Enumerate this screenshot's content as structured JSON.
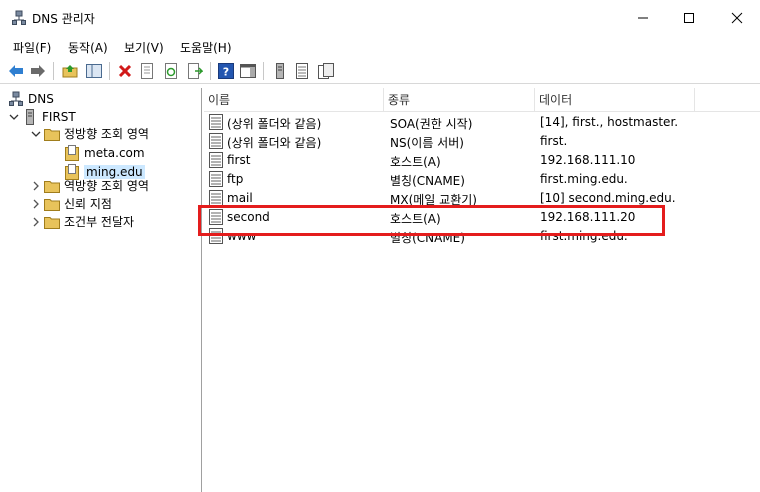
{
  "window": {
    "title": "DNS 관리자"
  },
  "menu": [
    "파일(F)",
    "동작(A)",
    "보기(V)",
    "도움말(H)"
  ],
  "toolbar": {
    "buttons": [
      "back-icon",
      "forward-icon",
      "up-folder-icon",
      "show-tree-icon",
      "delete-icon",
      "properties-icon",
      "refresh-icon",
      "export-icon",
      "help-icon",
      "action-pane-icon",
      "server-icon",
      "record-list-icon",
      "zone-icon"
    ]
  },
  "tree": {
    "root": "DNS",
    "server": "FIRST",
    "forward_zones": "정방향 조회 영역",
    "zone1": "meta.com",
    "zone2": "ming.edu",
    "reverse_zones": "역방향 조회 영역",
    "trust_points": "신뢰 지점",
    "conditional_forwarders": "조건부 전달자"
  },
  "list": {
    "columns": [
      "이름",
      "종류",
      "데이터"
    ],
    "rows": [
      {
        "name": "(상위 폴더와 같음)",
        "type": "SOA(권한 시작)",
        "data": "[14], first., hostmaster."
      },
      {
        "name": "(상위 폴더와 같음)",
        "type": "NS(이름 서버)",
        "data": "first."
      },
      {
        "name": "first",
        "type": "호스트(A)",
        "data": "192.168.111.10"
      },
      {
        "name": "ftp",
        "type": "별칭(CNAME)",
        "data": "first.ming.edu."
      },
      {
        "name": "mail",
        "type": "MX(메일 교환기)",
        "data": "[10]  second.ming.edu."
      },
      {
        "name": "second",
        "type": "호스트(A)",
        "data": "192.168.111.20"
      },
      {
        "name": "www",
        "type": "별칭(CNAME)",
        "data": "first.ming.edu."
      }
    ]
  },
  "colors": {
    "highlight": "#e41d1d",
    "selection": "#cce8ff",
    "folder": "#e8c35b"
  }
}
